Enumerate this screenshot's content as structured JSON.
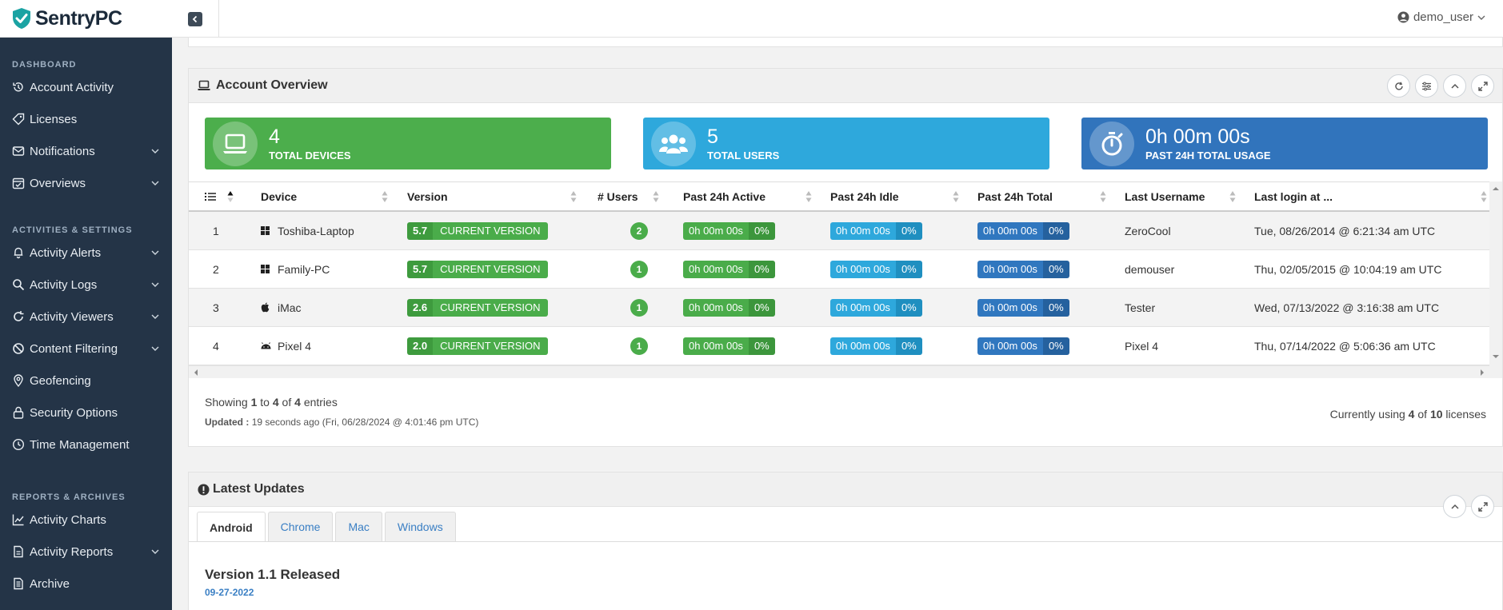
{
  "app": {
    "logo_text": "SentryPC"
  },
  "user": {
    "name": "demo_user"
  },
  "sidebar": {
    "sections": [
      {
        "title": "DASHBOARD",
        "items": [
          {
            "label": "Account Activity",
            "icon": "history-icon",
            "has_children": false
          },
          {
            "label": "Licenses",
            "icon": "tag-icon",
            "has_children": false
          },
          {
            "label": "Notifications",
            "icon": "envelope-icon",
            "has_children": true
          },
          {
            "label": "Overviews",
            "icon": "calendar-check-icon",
            "has_children": true
          }
        ]
      },
      {
        "title": "ACTIVITIES & SETTINGS",
        "items": [
          {
            "label": "Activity Alerts",
            "icon": "bell-icon",
            "has_children": true
          },
          {
            "label": "Activity Logs",
            "icon": "search-icon",
            "has_children": true
          },
          {
            "label": "Activity Viewers",
            "icon": "refresh-icon",
            "has_children": true
          },
          {
            "label": "Content Filtering",
            "icon": "ban-icon",
            "has_children": true
          },
          {
            "label": "Geofencing",
            "icon": "map-pin-icon",
            "has_children": false
          },
          {
            "label": "Security Options",
            "icon": "lock-icon",
            "has_children": false
          },
          {
            "label": "Time Management",
            "icon": "clock-icon",
            "has_children": false
          }
        ]
      },
      {
        "title": "REPORTS & ARCHIVES",
        "items": [
          {
            "label": "Activity Charts",
            "icon": "line-chart-icon",
            "has_children": false
          },
          {
            "label": "Activity Reports",
            "icon": "file-icon",
            "has_children": true
          },
          {
            "label": "Archive",
            "icon": "document-icon",
            "has_children": false
          }
        ]
      }
    ]
  },
  "overview": {
    "title": "Account Overview",
    "stats": [
      {
        "value": "4",
        "label": "TOTAL DEVICES",
        "color": "#4cae4c",
        "icon": "laptop-icon"
      },
      {
        "value": "5",
        "label": "TOTAL USERS",
        "color": "#2ea8dc",
        "icon": "users-icon"
      },
      {
        "value": "0h 00m 00s",
        "label": "PAST 24H TOTAL USAGE",
        "color": "#3174bc",
        "icon": "stopwatch-icon"
      }
    ],
    "columns": [
      "Device",
      "Version",
      "# Users",
      "Past 24h Active",
      "Past 24h Idle",
      "Past 24h Total",
      "Last Username",
      "Last login at ..."
    ],
    "rows": [
      {
        "num": "1",
        "os": "windows",
        "device": "Toshiba-Laptop",
        "ver": "5.7",
        "ver_text": "CURRENT VERSION",
        "users": "2",
        "active": "0h 00m 00s",
        "active_pct": "0%",
        "idle": "0h 00m 00s",
        "idle_pct": "0%",
        "total": "0h 00m 00s",
        "total_pct": "0%",
        "username": "ZeroCool",
        "login": "Tue, 08/26/2014 @ 6:21:34 am UTC"
      },
      {
        "num": "2",
        "os": "windows",
        "device": "Family-PC",
        "ver": "5.7",
        "ver_text": "CURRENT VERSION",
        "users": "1",
        "active": "0h 00m 00s",
        "active_pct": "0%",
        "idle": "0h 00m 00s",
        "idle_pct": "0%",
        "total": "0h 00m 00s",
        "total_pct": "0%",
        "username": "demouser",
        "login": "Thu, 02/05/2015 @ 10:04:19 am UTC"
      },
      {
        "num": "3",
        "os": "apple",
        "device": "iMac",
        "ver": "2.6",
        "ver_text": "CURRENT VERSION",
        "users": "1",
        "active": "0h 00m 00s",
        "active_pct": "0%",
        "idle": "0h 00m 00s",
        "idle_pct": "0%",
        "total": "0h 00m 00s",
        "total_pct": "0%",
        "username": "Tester",
        "login": "Wed, 07/13/2022 @ 3:16:38 am UTC"
      },
      {
        "num": "4",
        "os": "android",
        "device": "Pixel 4",
        "ver": "2.0",
        "ver_text": "CURRENT VERSION",
        "users": "1",
        "active": "0h 00m 00s",
        "active_pct": "0%",
        "idle": "0h 00m 00s",
        "idle_pct": "0%",
        "total": "0h 00m 00s",
        "total_pct": "0%",
        "username": "Pixel 4",
        "login": "Thu, 07/14/2022 @ 5:06:36 am UTC"
      }
    ],
    "showing": {
      "prefix": "Showing",
      "from": "1",
      "to_word": "to",
      "to": "4",
      "of_word": "of",
      "total": "4",
      "suffix": "entries"
    },
    "updated": {
      "label": "Updated :",
      "text": "19 seconds ago (Fri, 06/28/2024 @ 4:01:46 pm UTC)"
    },
    "licenses": {
      "prefix": "Currently using",
      "used": "4",
      "of_word": "of",
      "total": "10",
      "suffix": "licenses"
    }
  },
  "updates": {
    "title": "Latest Updates",
    "tabs": [
      "Android",
      "Chrome",
      "Mac",
      "Windows"
    ],
    "active_tab": "Android",
    "entry_title": "Version 1.1 Released",
    "entry_date": "09-27-2022"
  }
}
